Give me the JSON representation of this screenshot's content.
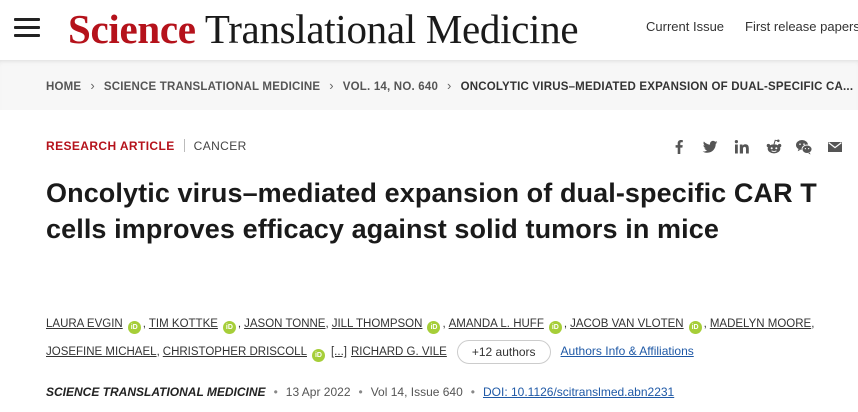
{
  "header": {
    "logo_science": "Science",
    "logo_journal": " Translational Medicine",
    "nav": [
      "Current Issue",
      "First release papers"
    ]
  },
  "breadcrumb": [
    "HOME",
    "SCIENCE TRANSLATIONAL MEDICINE",
    "VOL. 14, NO. 640",
    "ONCOLYTIC VIRUS–MEDIATED EXPANSION OF DUAL-SPECIFIC CA..."
  ],
  "article": {
    "type": "RESEARCH ARTICLE",
    "category": "CANCER",
    "title": "Oncolytic virus–mediated expansion of dual-specific CAR T cells improves efficacy against solid tumors in mice",
    "authors_row1": [
      "LAURA EVGIN",
      "TIM KOTTKE",
      "JASON TONNE",
      "JILL THOMPSON",
      "AMANDA L. HUFF",
      "JACOB VAN VLOTEN",
      "MADELYN MOORE"
    ],
    "authors_row2": [
      "JOSEFINE MICHAEL",
      "CHRISTOPHER DRISCOLL"
    ],
    "ellipsis": "[...]",
    "last_author": "RICHARD G. VILE",
    "more_authors": "+12 authors",
    "affiliations_link": "Authors Info & Affiliations",
    "orcid_label": "iD"
  },
  "citation": {
    "journal": "SCIENCE TRANSLATIONAL MEDICINE",
    "date": "13 Apr 2022",
    "volume": "Vol 14, Issue 640",
    "doi": "DOI: 10.1126/scitranslmed.abn2231"
  },
  "share_icons": [
    "facebook-icon",
    "twitter-icon",
    "linkedin-icon",
    "reddit-icon",
    "wechat-icon",
    "email-icon"
  ],
  "colors": {
    "brand_red": "#b5121b",
    "link_blue": "#1f59a6",
    "orcid_green": "#a6ce39"
  }
}
